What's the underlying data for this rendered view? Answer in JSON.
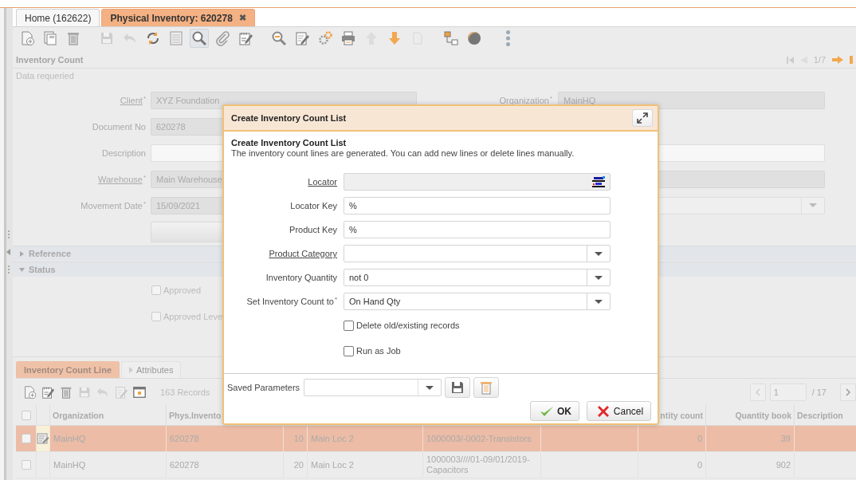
{
  "required_mark": "*",
  "tabs": [
    {
      "label": "Home (162622)",
      "selected": false
    },
    {
      "label": "Physical Inventory: 620278",
      "selected": true,
      "close": "✖"
    }
  ],
  "toolbar": {
    "groups": [
      {
        "items": [
          {
            "kind": "new",
            "disabled": false,
            "selected": false
          },
          {
            "kind": "copy",
            "disabled": false,
            "selected": false
          },
          {
            "kind": "delete",
            "disabled": false,
            "selected": false
          }
        ]
      },
      {
        "items": [
          {
            "kind": "save",
            "disabled": true,
            "selected": false
          },
          {
            "kind": "undo",
            "disabled": true,
            "selected": false
          },
          {
            "kind": "refresh",
            "disabled": false,
            "selected": false
          },
          {
            "kind": "form",
            "disabled": false,
            "selected": false
          },
          {
            "kind": "search",
            "disabled": false,
            "selected": true
          },
          {
            "kind": "attach",
            "disabled": false,
            "selected": false
          },
          {
            "kind": "note",
            "disabled": false,
            "selected": false
          }
        ]
      },
      {
        "items": [
          {
            "kind": "zoom",
            "disabled": false,
            "selected": false
          },
          {
            "kind": "edit",
            "disabled": false,
            "selected": false
          },
          {
            "kind": "process",
            "disabled": false,
            "selected": false
          },
          {
            "kind": "print",
            "disabled": false,
            "selected": false
          },
          {
            "kind": "up",
            "disabled": true,
            "selected": false
          },
          {
            "kind": "down",
            "disabled": false,
            "selected": false
          },
          {
            "kind": "document",
            "disabled": true,
            "selected": false
          }
        ]
      },
      {
        "items": [
          {
            "kind": "tree",
            "disabled": false,
            "selected": false
          },
          {
            "kind": "logo",
            "disabled": false,
            "selected": false
          }
        ]
      },
      {
        "items": [
          {
            "kind": "more",
            "disabled": false,
            "selected": false
          }
        ]
      }
    ]
  },
  "header": {
    "title": "Inventory Count",
    "record_position": "1/7",
    "message": "Data requeried"
  },
  "form": {
    "left": [
      {
        "kind": "text",
        "label": "Client",
        "link": true,
        "required": true,
        "readonly": true,
        "value": "XYZ Foundation"
      },
      {
        "kind": "text",
        "label": "Document No",
        "link": false,
        "required": false,
        "readonly": true,
        "value": "620278"
      },
      {
        "kind": "text",
        "label": "Description",
        "link": false,
        "required": false,
        "readonly": false
      },
      {
        "kind": "text",
        "label": "Warehouse",
        "link": true,
        "required": true,
        "readonly": true,
        "value": "Main Warehouse"
      },
      {
        "kind": "text",
        "label": "Movement Date",
        "link": false,
        "required": true,
        "readonly": true,
        "value": "15/09/2021"
      },
      {
        "kind": "button"
      }
    ],
    "right": [
      {
        "kind": "text",
        "label": "Organization",
        "required": true,
        "readonly": true,
        "value": "MainHQ"
      },
      {
        "kind": "blank"
      },
      {
        "kind": "text",
        "readonly": false
      },
      {
        "kind": "text",
        "readonly": true
      },
      {
        "kind": "dropdown"
      }
    ]
  },
  "sections": [
    {
      "label": "Reference",
      "expanded": false
    },
    {
      "label": "Status",
      "expanded": true,
      "checkboxes": [
        {
          "label": "Approved",
          "checked": false
        },
        {
          "label": "Approved Leve",
          "checked": false
        }
      ]
    }
  ],
  "grid": {
    "tabs": [
      {
        "label": "Inventory Count Line",
        "selected": true,
        "collapsed": false
      },
      {
        "label": "Attributes",
        "selected": false,
        "collapsed": true
      }
    ],
    "toolbar": [
      {
        "kind": "new",
        "disabled": false
      },
      {
        "kind": "note",
        "disabled": false
      },
      {
        "kind": "delete",
        "disabled": false
      },
      {
        "kind": "save",
        "disabled": true
      },
      {
        "kind": "undo",
        "disabled": true
      },
      {
        "kind": "edit",
        "disabled": true
      },
      {
        "kind": "window",
        "disabled": false
      }
    ],
    "record_count": "163 Records",
    "page": "1",
    "page_total": "/ 17",
    "select_all_checked": false,
    "columns": [
      {
        "label": "Organization",
        "kind": "text"
      },
      {
        "label": "Phys.Invento",
        "kind": "text"
      },
      {
        "kind": "number"
      },
      {
        "kind": "text"
      },
      {
        "kind": "text"
      },
      {
        "kind": "text"
      },
      {
        "label": "ntity count",
        "kind": "number"
      },
      {
        "label": "Quantity book",
        "kind": "number"
      },
      {
        "label": "Description",
        "kind": "text"
      }
    ],
    "rows": [
      {
        "selected": true,
        "checked": false,
        "cells": [
          "MainHQ",
          "620278",
          "10",
          "Main Loc 2",
          "1000003/-0002-Transistors",
          null,
          "0",
          "39",
          null
        ]
      },
      {
        "selected": false,
        "checked": false,
        "cells": [
          "MainHQ",
          "620278",
          "20",
          "Main Loc 2",
          "1000003////01-09/01/2019-Capacitors",
          null,
          "0",
          "902",
          null
        ]
      }
    ]
  },
  "dialog": {
    "title": "Create Inventory Count List",
    "heading": "Create Inventory Count List",
    "description": "The inventory count lines are generated. You can add new lines or delete lines manually.",
    "params": [
      {
        "kind": "selector",
        "label": "Locator",
        "link": true,
        "required": false
      },
      {
        "kind": "text",
        "label": "Locator Key",
        "link": false,
        "required": false,
        "value": "%"
      },
      {
        "kind": "text",
        "label": "Product Key",
        "link": false,
        "required": false,
        "value": "%"
      },
      {
        "kind": "dropdown",
        "label": "Product Category",
        "link": true,
        "required": false
      },
      {
        "kind": "dropdown",
        "label": "Inventory Quantity",
        "link": false,
        "required": false,
        "value": "not 0"
      },
      {
        "kind": "dropdown",
        "label": "Set Inventory Count to",
        "link": false,
        "required": true,
        "value": "On Hand Qty"
      },
      {
        "kind": "checkbox",
        "label": "Delete old/existing records",
        "checked": false
      },
      {
        "kind": "checkbox",
        "label": "Run as Job",
        "checked": false
      }
    ],
    "saved_parameters": {
      "label": "Saved Parameters"
    },
    "buttons": [
      {
        "kind": "ok",
        "label": "OK"
      },
      {
        "kind": "cancel",
        "label": "Cancel"
      }
    ]
  }
}
